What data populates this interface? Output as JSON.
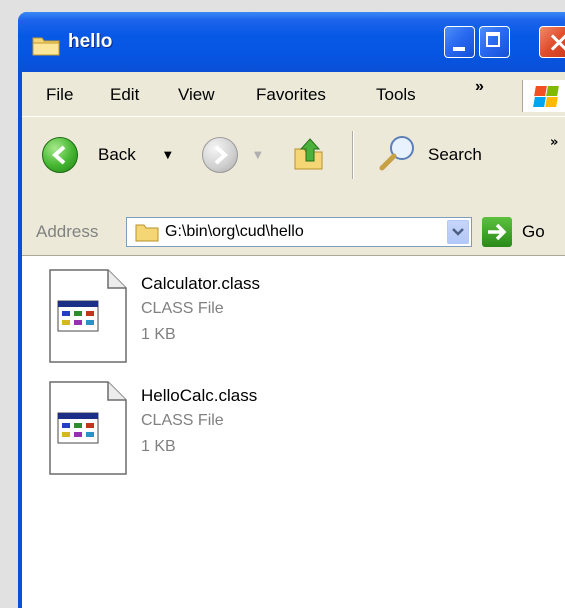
{
  "window": {
    "title": "hello"
  },
  "menubar": {
    "items": [
      "File",
      "Edit",
      "View",
      "Favorites",
      "Tools"
    ],
    "overflow": "»"
  },
  "toolbar": {
    "back_label": "Back",
    "search_label": "Search",
    "overflow": "»"
  },
  "addressbar": {
    "label": "Address",
    "path": "G:\\bin\\org\\cud\\hello",
    "go_label": "Go"
  },
  "files": [
    {
      "name": "Calculator.class",
      "type": "CLASS File",
      "size": "1 KB"
    },
    {
      "name": "HelloCalc.class",
      "type": "CLASS File",
      "size": "1 KB"
    }
  ],
  "colors": {
    "titlebar": "#0858e6",
    "chrome": "#ece9d8",
    "content": "#ffffff",
    "secondary_text": "#808080"
  }
}
